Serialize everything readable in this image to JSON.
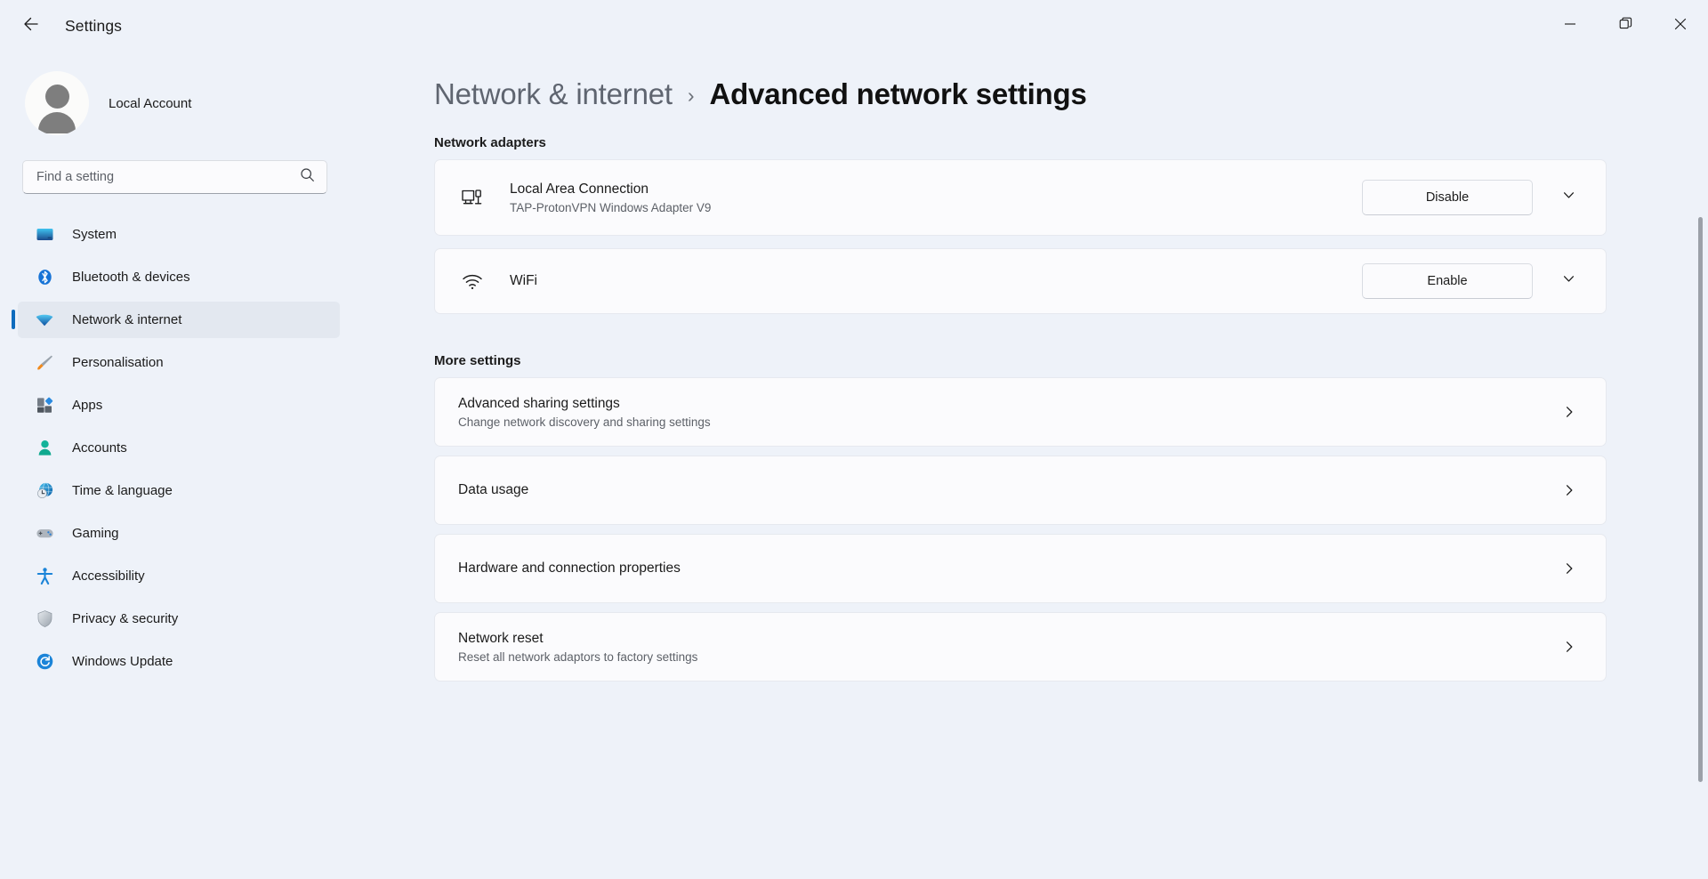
{
  "titlebar": {
    "app_title": "Settings",
    "back_icon": "arrow-left-icon",
    "minimize_icon": "minimize-icon",
    "restore_icon": "restore-icon",
    "close_icon": "close-icon"
  },
  "sidebar": {
    "account_name": "Local Account",
    "search": {
      "placeholder": "Find a setting",
      "value": "",
      "icon": "search-icon"
    },
    "items": [
      {
        "label": "System",
        "icon": "system-icon",
        "selected": false
      },
      {
        "label": "Bluetooth & devices",
        "icon": "bluetooth-icon",
        "selected": false
      },
      {
        "label": "Network & internet",
        "icon": "wifi-icon",
        "selected": true
      },
      {
        "label": "Personalisation",
        "icon": "brush-icon",
        "selected": false
      },
      {
        "label": "Apps",
        "icon": "apps-icon",
        "selected": false
      },
      {
        "label": "Accounts",
        "icon": "account-icon",
        "selected": false
      },
      {
        "label": "Time & language",
        "icon": "clock-globe-icon",
        "selected": false
      },
      {
        "label": "Gaming",
        "icon": "gamepad-icon",
        "selected": false
      },
      {
        "label": "Accessibility",
        "icon": "accessibility-icon",
        "selected": false
      },
      {
        "label": "Privacy & security",
        "icon": "shield-icon",
        "selected": false
      },
      {
        "label": "Windows Update",
        "icon": "update-icon",
        "selected": false
      }
    ]
  },
  "main": {
    "breadcrumb": {
      "parent": "Network & internet",
      "separator": "›",
      "current": "Advanced network settings"
    },
    "adapters_section": {
      "title": "Network adapters",
      "items": [
        {
          "name": "Local Area Connection",
          "description": "TAP-ProtonVPN Windows Adapter V9",
          "icon": "ethernet-icon",
          "action_label": "Disable",
          "expander_icon": "chevron-down-icon"
        },
        {
          "name": "WiFi",
          "description": "",
          "icon": "wifi-icon",
          "action_label": "Enable",
          "expander_icon": "chevron-down-icon"
        }
      ]
    },
    "more_section": {
      "title": "More settings",
      "items": [
        {
          "title": "Advanced sharing settings",
          "description": "Change network discovery and sharing settings",
          "chevron_icon": "chevron-right-icon"
        },
        {
          "title": "Data usage",
          "description": "",
          "chevron_icon": "chevron-right-icon"
        },
        {
          "title": "Hardware and connection properties",
          "description": "",
          "chevron_icon": "chevron-right-icon"
        },
        {
          "title": "Network reset",
          "description": "Reset all network adaptors to factory settings",
          "chevron_icon": "chevron-right-icon"
        }
      ]
    }
  },
  "colors": {
    "accent": "#0f6cbd",
    "page_background": "#eef2f9",
    "card_background": "#fbfbfd",
    "selected_nav_background": "#e3e8f0"
  }
}
